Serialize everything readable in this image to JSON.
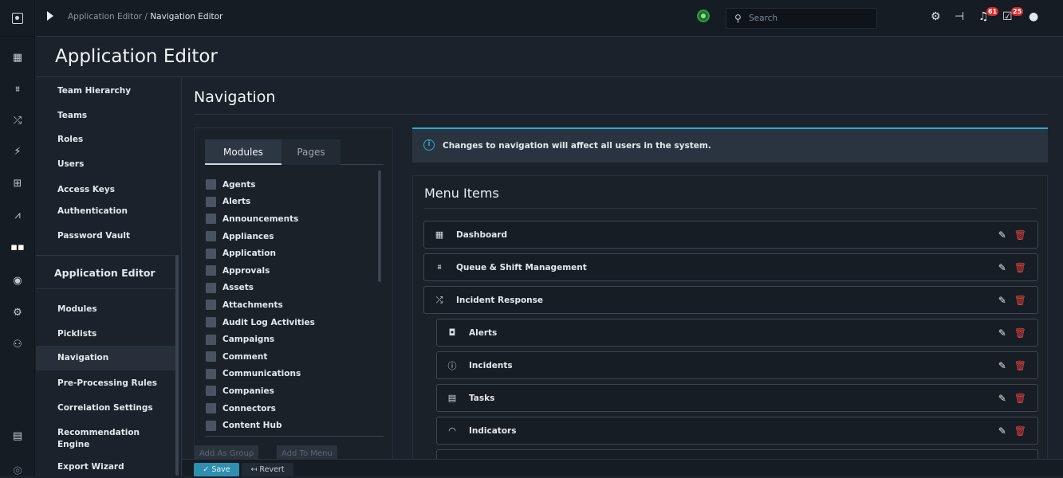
{
  "topbar": {
    "breadcrumb_parent": "Application Editor /",
    "breadcrumb_current": "Navigation Editor",
    "search_placeholder": "Search",
    "notifications_count": "61",
    "tasks_count": "25"
  },
  "page_title": "Application Editor",
  "subnav": {
    "items_top": [
      "Team Hierarchy",
      "Teams",
      "Roles",
      "Users",
      "Access Keys",
      "Authentication",
      "Password Vault"
    ],
    "section_title": "Application Editor",
    "items_bottom": [
      "Modules",
      "Picklists",
      "Navigation",
      "Pre-Processing Rules",
      "Correlation Settings",
      "Recommendation Engine",
      "Export Wizard"
    ],
    "active_item": "Navigation"
  },
  "main": {
    "title": "Navigation",
    "tabs": [
      "Modules",
      "Pages"
    ],
    "modules": [
      "Agents",
      "Alerts",
      "Announcements",
      "Appliances",
      "Application",
      "Approvals",
      "Assets",
      "Attachments",
      "Audit Log Activities",
      "Campaigns",
      "Comment",
      "Communications",
      "Companies",
      "Connectors",
      "Content Hub"
    ],
    "add_group_label": "Add As Group",
    "add_menu_label": "Add To Menu",
    "info_icon": "info-icon",
    "info_text": "Changes to navigation will affect all users in the system.",
    "menu_title": "Menu Items",
    "menu_items": [
      {
        "label": "Dashboard",
        "icon": "dashboard-icon",
        "level": 0
      },
      {
        "label": "Queue & Shift Management",
        "icon": "team-icon",
        "level": 0
      },
      {
        "label": "Incident Response",
        "icon": "shuffle-icon",
        "level": 0
      },
      {
        "label": "Alerts",
        "icon": "alert-icon",
        "level": 1
      },
      {
        "label": "Incidents",
        "icon": "incident-icon",
        "level": 1
      },
      {
        "label": "Tasks",
        "icon": "task-icon",
        "level": 1
      },
      {
        "label": "Indicators",
        "icon": "indicator-icon",
        "level": 1
      }
    ]
  },
  "bottombar": {
    "save_label": "Save",
    "revert_label": "Revert"
  },
  "colors": {
    "accent": "#2fa8c9",
    "danger": "#e0423f",
    "save": "#2f8fb0"
  }
}
